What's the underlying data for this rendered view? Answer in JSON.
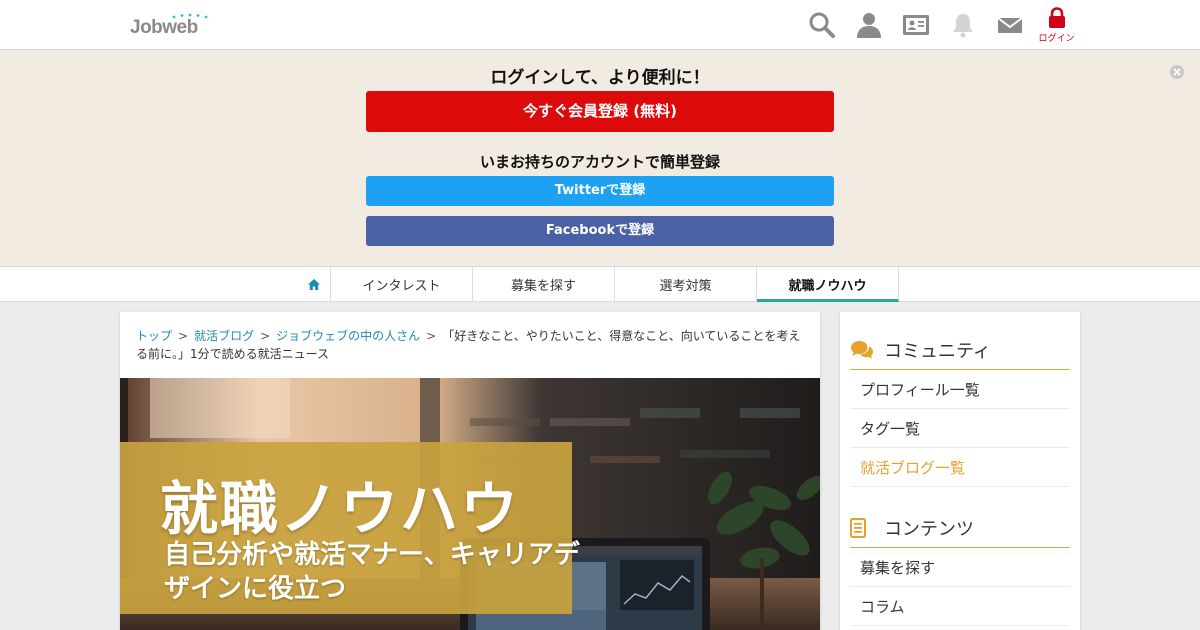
{
  "header": {
    "logo": "Jobweb",
    "icons": [
      "search-icon",
      "user-icon",
      "profile-card-icon",
      "notification-bell-icon",
      "mail-icon",
      "lock-icon"
    ],
    "login_label": "ログイン"
  },
  "banner": {
    "title": "ログインして、より便利に！",
    "register_button": "今すぐ会員登録 (無料)",
    "subtitle": "いまお持ちのアカウントで簡単登録",
    "twitter_button": "Twitterで登録",
    "facebook_button": "Facebookで登録",
    "close_icon": "close-icon"
  },
  "nav": {
    "home_icon": "home-icon",
    "tabs": [
      {
        "label": "インタレスト",
        "active": false
      },
      {
        "label": "募集を探す",
        "active": false
      },
      {
        "label": "選考対策",
        "active": false
      },
      {
        "label": "就職ノウハウ",
        "active": true
      }
    ]
  },
  "breadcrumb": {
    "items": [
      "トップ",
      "就活ブログ",
      "ジョブウェブの中の人さん"
    ],
    "separator": ">",
    "current": "「好きなこと、やりたいこと、得意なこと、向いていることを考える前に。」1分で読める就活ニュース"
  },
  "hero": {
    "title": "就職ノウハウ",
    "subtitle": "自己分析や就活マナー、キャリアデザインに役立つ"
  },
  "sidebar": {
    "community": {
      "heading": "コミュニティ",
      "icon": "chat-bubbles-icon",
      "items": [
        {
          "label": "プロフィール一覧",
          "active": false
        },
        {
          "label": "タグ一覧",
          "active": false
        },
        {
          "label": "就活ブログ一覧",
          "active": true
        }
      ]
    },
    "contents": {
      "heading": "コンテンツ",
      "icon": "document-icon",
      "items": [
        {
          "label": "募集を探す",
          "active": false
        },
        {
          "label": "コラム",
          "active": false
        }
      ]
    }
  },
  "colors": {
    "register_red": "#dc0a0a",
    "twitter_blue": "#1da1f2",
    "facebook_blue": "#4a62a5",
    "banner_bg": "#f2ebe2",
    "active_tab_underline": "#2aa6a1",
    "sidebar_accent": "#e5a12c",
    "hero_overlay": "#c9a33e",
    "link_blue": "#1b8ab8"
  }
}
